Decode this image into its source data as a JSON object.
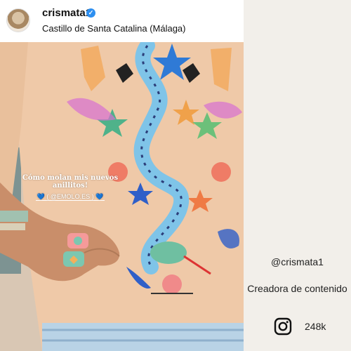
{
  "post": {
    "username": "crismata1",
    "location": "Castillo de Santa Catalina (Málaga)",
    "story_caption": "Cómo molan mis nuevos anillitos!",
    "story_tag": "💙 ( @EMOLO.ES ) 💙"
  },
  "profile_card": {
    "handle": "@crismata1",
    "role": "Creadora de contenido",
    "followers": "248k",
    "platform_icon": "instagram-icon"
  },
  "colors": {
    "shirt": "#efc9a8",
    "background": "#f2efea",
    "verified": "#2d8ff0"
  }
}
